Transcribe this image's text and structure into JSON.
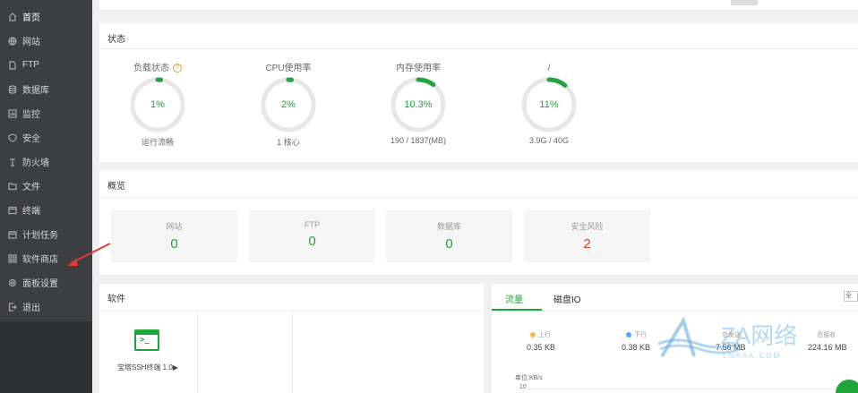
{
  "sidebar": {
    "items": [
      {
        "label": "首页",
        "icon": "home-icon",
        "active": true
      },
      {
        "label": "网站",
        "icon": "globe-icon"
      },
      {
        "label": "FTP",
        "icon": "ftp-icon"
      },
      {
        "label": "数据库",
        "icon": "database-icon"
      },
      {
        "label": "监控",
        "icon": "monitor-icon"
      },
      {
        "label": "安全",
        "icon": "shield-icon"
      },
      {
        "label": "防火墙",
        "icon": "firewall-icon"
      },
      {
        "label": "文件",
        "icon": "folder-icon"
      },
      {
        "label": "终端",
        "icon": "terminal-icon"
      },
      {
        "label": "计划任务",
        "icon": "calendar-icon"
      },
      {
        "label": "软件商店",
        "icon": "grid-icon"
      },
      {
        "label": "面板设置",
        "icon": "gear-icon"
      },
      {
        "label": "退出",
        "icon": "logout-icon"
      }
    ]
  },
  "status": {
    "title": "状态",
    "gauges": [
      {
        "label": "负载状态",
        "value": "1%",
        "percent": 1,
        "sub": "运行流畅",
        "help": "?"
      },
      {
        "label": "CPU使用率",
        "value": "2%",
        "percent": 2,
        "sub": "1 核心"
      },
      {
        "label": "内存使用率",
        "value": "10.3%",
        "percent": 10.3,
        "sub": "190 / 1837(MB)"
      },
      {
        "label": "/",
        "value": "11%",
        "percent": 11,
        "sub": "3.9G / 40G"
      }
    ]
  },
  "overview": {
    "title": "概览",
    "cards": [
      {
        "label": "网站",
        "value": "0"
      },
      {
        "label": "FTP",
        "value": "0"
      },
      {
        "label": "数据库",
        "value": "0"
      },
      {
        "label": "安全风险",
        "value": "2",
        "alert": true
      }
    ]
  },
  "software": {
    "title": "软件",
    "items": [
      {
        "name": "宝塔SSH终端 1.0▶",
        "icon": "terminal-icon"
      }
    ]
  },
  "traffic": {
    "tabs": [
      "流量",
      "磁盘IO"
    ],
    "upload": {
      "label": "上行",
      "value": "0.35 KB"
    },
    "download": {
      "label": "下行",
      "value": "0.38 KB"
    },
    "total_sent": {
      "label": "总发送",
      "value": "7.56 MB"
    },
    "total_recv": {
      "label": "总接收",
      "value": "224.16 MB"
    },
    "unit": "单位:KB/s",
    "y_tick": "10",
    "corner": "全部"
  },
  "colors": {
    "accent": "#20a53a",
    "upload": "#f7b851",
    "download": "#52a9ff",
    "danger": "#e03b2a"
  }
}
